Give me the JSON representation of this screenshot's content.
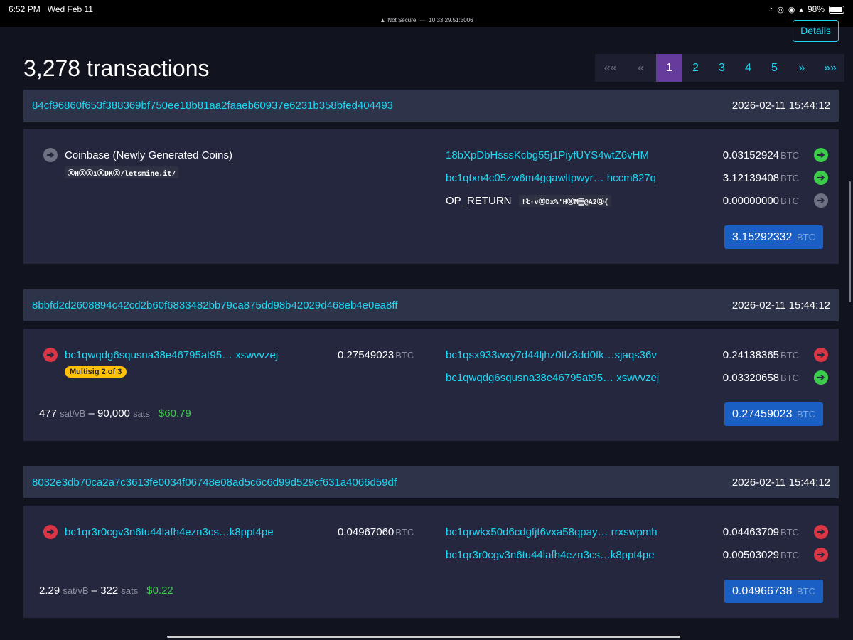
{
  "status": {
    "time": "6:52 PM",
    "date": "Wed Feb 11",
    "battery": "98%",
    "security": "Not Secure",
    "url": "10.33.29.51:3006"
  },
  "details_label": "Details",
  "title": "3,278 transactions",
  "pagination": {
    "first": "««",
    "prev": "«",
    "pages": [
      "1",
      "2",
      "3",
      "4",
      "5"
    ],
    "active_page": "1",
    "next": "»",
    "last": "»»"
  },
  "unit": "BTC",
  "transactions": [
    {
      "hash": "84cf96860f653f388369bf750ee18b81aa2faaeb60937e6231b358bfed404493",
      "time": "2026-02-11 15:44:12",
      "input": {
        "label": "Coinbase (Newly Generated Coins)",
        "script": "ⓍHⓍⓍıⓍDKⓍ/letsmine.it/"
      },
      "outputs": [
        {
          "address": "18bXpDbHsssKcbg55j1PiyfUYS4wtZ6vHM",
          "amount": "0.03152924",
          "status": "green"
        },
        {
          "address": "bc1qtxn4c05zw6m4gqawltpwyr… hccm827q",
          "amount": "3.12139408",
          "status": "green"
        },
        {
          "address": "OP_RETURN",
          "data": "!ł·vⓍDx%'HⓍM𝄛@A2Ⓠ{",
          "amount": "0.00000000",
          "status": "gray"
        }
      ],
      "total": "3.15292332"
    },
    {
      "hash": "8bbfd2d2608894c42cd2b60f6833482bb79ca875dd98b42029d468eb4e0ea8ff",
      "time": "2026-02-11 15:44:12",
      "input": {
        "address": "bc1qwqdg6squsna38e46795at95… xswvvzej",
        "amount": "0.27549023",
        "badge": "Multisig 2 of 3"
      },
      "outputs": [
        {
          "address": "bc1qsx933wxy7d44ljhz0tlz3dd0fk…sjaqs36v",
          "amount": "0.24138365",
          "status": "red"
        },
        {
          "address": "bc1qwqdg6squsna38e46795at95… xswvvzej",
          "amount": "0.03320658",
          "status": "green"
        }
      ],
      "fee_rate": "477",
      "fee_rate_unit": "sat/vB",
      "fee_sats": "90,000",
      "fee_sats_unit": "sats",
      "fee_usd": "$60.79",
      "total": "0.27459023"
    },
    {
      "hash": "8032e3db70ca2a7c3613fe0034f06748e08ad5c6c6d99d529cf631a4066d59df",
      "time": "2026-02-11 15:44:12",
      "input": {
        "address": "bc1qr3r0cgv3n6tu44lafh4ezn3cs…k8ppt4pe",
        "amount": "0.04967060"
      },
      "outputs": [
        {
          "address": "bc1qrwkx50d6cdgfjt6vxa58qpay… rrxswpmh",
          "amount": "0.04463709",
          "status": "red"
        },
        {
          "address": "bc1qr3r0cgv3n6tu44lafh4ezn3cs…k8ppt4pe",
          "amount": "0.00503029",
          "status": "red"
        }
      ],
      "fee_rate": "2.29",
      "fee_rate_unit": "sat/vB",
      "fee_sats": "322",
      "fee_sats_unit": "sats",
      "fee_usd": "$0.22",
      "total": "0.04966738"
    }
  ],
  "colors": {
    "accent": "#1bd8f4",
    "active_page": "#653b9c",
    "green": "#3bcc49",
    "red": "#dc3545",
    "total_button": "#1a5fc3",
    "badge": "#ffc107"
  }
}
